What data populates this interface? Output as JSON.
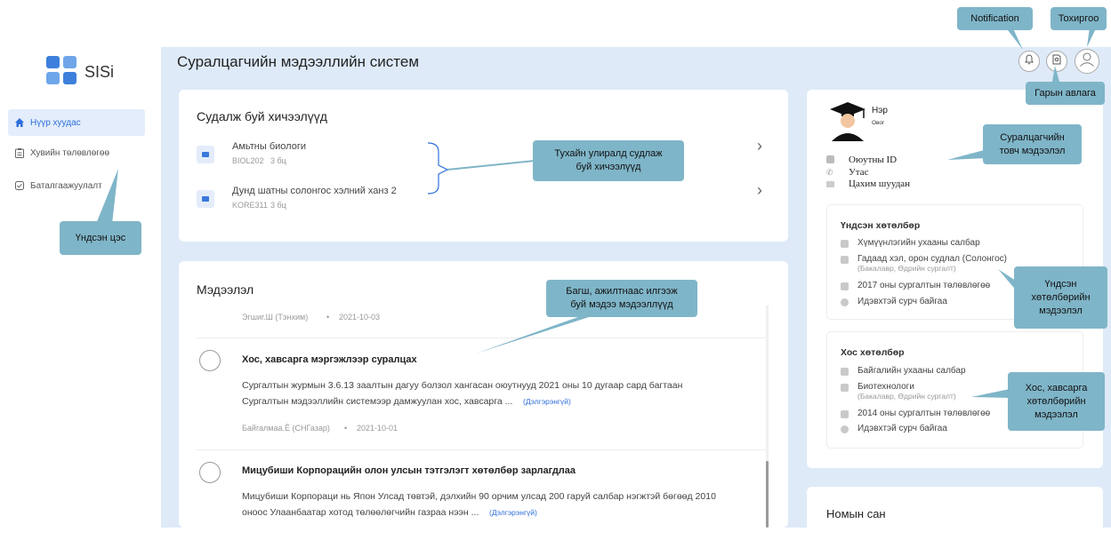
{
  "app": {
    "name": "SISi",
    "page_title": "Суралцагчийн мэдээллийн систем"
  },
  "sidebar": {
    "items": [
      {
        "label": "Нүүр хуудас",
        "icon": "home-icon",
        "active": true
      },
      {
        "label": "Хувийн төлөвлөгөө",
        "icon": "clipboard-icon",
        "active": false
      },
      {
        "label": "Баталгаажуулалт",
        "icon": "check-square-icon",
        "active": false
      }
    ]
  },
  "courses": {
    "title": "Судалж буй хичээлүүд",
    "items": [
      {
        "name": "Амьтны биологи",
        "code": "BIOL202",
        "credits": "3 бц"
      },
      {
        "name": "Дунд шатны солонгос хэлний ханз 2",
        "code": "KORE311",
        "credits": "3 бц"
      }
    ]
  },
  "news": {
    "title": "Мэдээлэл",
    "items": [
      {
        "author": "Эгшиг.Ш (Тэнхим)",
        "date": "2021-10-03"
      },
      {
        "title": "Хос, хавсарга мэргэжлээр суралцах",
        "body_1": "Сургалтын журмын 3.6.13 заалтын дагуу болзол хангасан оюутнууд 2021 оны 10 дугаар сард багтаан",
        "body_2": "Сургалтын мэдээллийн системээр дамжуулан хос, хавсарга ...",
        "more": "(Дэлгэрэнгүй)",
        "author": "Байгалмаа.Ё (СНГазар)",
        "date": "2021-10-01"
      },
      {
        "title": "Мицубиши Корпорацийн олон улсын тэтгэлэгт хөтөлбөр зарлагдлаа",
        "body_1": "Мицубиши Корпораци нь Япон Улсад төвтэй, дэлхийн 90 орчим улсад 200 гаруй салбар нэгжтэй бөгөөд 2010",
        "body_2": "оноос Улаанбаатар хотод төлөөлөгчийн газраа нээн ...",
        "more": "(Дэлгэрэнгүй)"
      }
    ]
  },
  "profile": {
    "name": "Нэр",
    "surname": "Овог",
    "fields": [
      "Оюутны ID",
      "Утас",
      "Цахим шуудан"
    ]
  },
  "main_program": {
    "title": "Үндсэн хөтөлбөр",
    "rows": [
      {
        "text": "Хүмүүнлэгийн ухааны салбар"
      },
      {
        "text": "Гадаад хэл, орон судлал (Солонгос)",
        "sub": "(Бакалавр, Өдрийн сургалт)"
      },
      {
        "text": "2017 оны сургалтын төлөвлөгөө"
      },
      {
        "text": "Идэвхтэй сурч байгаа"
      }
    ]
  },
  "second_program": {
    "title": "Хос хөтөлбөр",
    "rows": [
      {
        "text": "Байгалийн ухааны салбар"
      },
      {
        "text": "Биотехнологи",
        "sub": "(Бакалавр, Өдрийн сургалт)"
      },
      {
        "text": "2014 оны сургалтын төлөвлөгөө"
      },
      {
        "text": "Идэвхтэй сурч байгаа"
      }
    ]
  },
  "library": {
    "title": "Номын сан"
  },
  "callouts": {
    "notification": "Notification",
    "settings": "Тохиргоо",
    "manual": "Гарын авлага",
    "main_menu": "Үндсэн цэс",
    "courses_1": "Тухайн улиралд судлаж",
    "courses_2": "буй хичээлүүд",
    "news_1": "Багш, ажилтнаас илгээж",
    "news_2": "буй мэдээ мэдээллүүд",
    "student_1": "Суралцагчийн",
    "student_2": "товч мэдээлэл",
    "main_prog_1": "Үндсэн",
    "main_prog_2": "хөтөлбөрийн",
    "main_prog_3": "мэдээлэл",
    "second_prog_1": "Хос, хавсарга",
    "second_prog_2": "хөтөлбөрийн",
    "second_prog_3": "мэдээлэл"
  },
  "colors": {
    "accent": "#2f6fdc",
    "background": "#deeaf8",
    "callout": "#7fb5c8"
  }
}
